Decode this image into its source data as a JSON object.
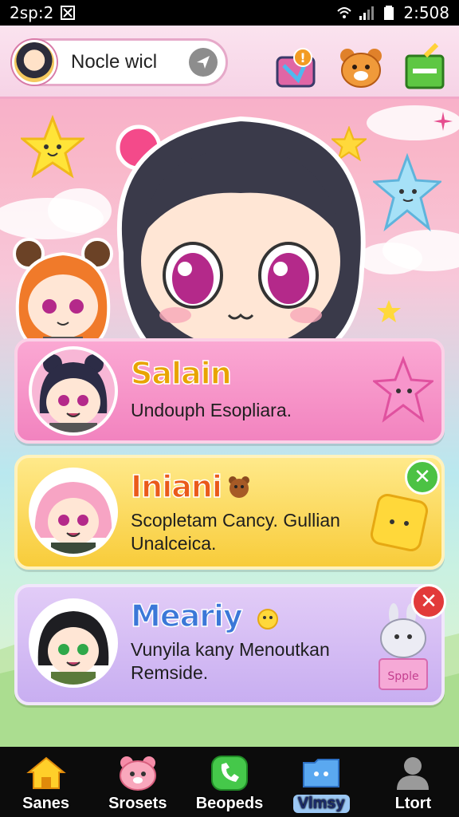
{
  "status_bar": {
    "left_text": "2sp:2",
    "time": "2:508"
  },
  "header": {
    "search_text": "Nocle wicl",
    "badge_text": "!"
  },
  "cards": [
    {
      "title": "Salain",
      "description": "Undouph Esopliara.",
      "title_color": "#e8a400"
    },
    {
      "title": "Iniani",
      "description": "Scopletam Cancy. Gullian Unalceica.",
      "title_color": "#ea5a1a",
      "badge": "✕"
    },
    {
      "title": "Meariy",
      "description": "Vunyila kany Menoutkan Remside.",
      "title_color": "#3b78d8",
      "badge": "✕",
      "sticker_text": "Spple"
    }
  ],
  "bottom_nav": [
    {
      "label": "Sanes",
      "icon": "home-icon"
    },
    {
      "label": "Srosets",
      "icon": "bear-icon"
    },
    {
      "label": "Beopeds",
      "icon": "phone-icon"
    },
    {
      "label": "Vlmsy",
      "icon": "folder-icon",
      "active": true
    },
    {
      "label": "Ltort",
      "icon": "profile-icon"
    }
  ],
  "colors": {
    "accent_pink": "#f283bf",
    "accent_yellow": "#f8cc3a",
    "accent_lilac": "#c8aef1"
  }
}
